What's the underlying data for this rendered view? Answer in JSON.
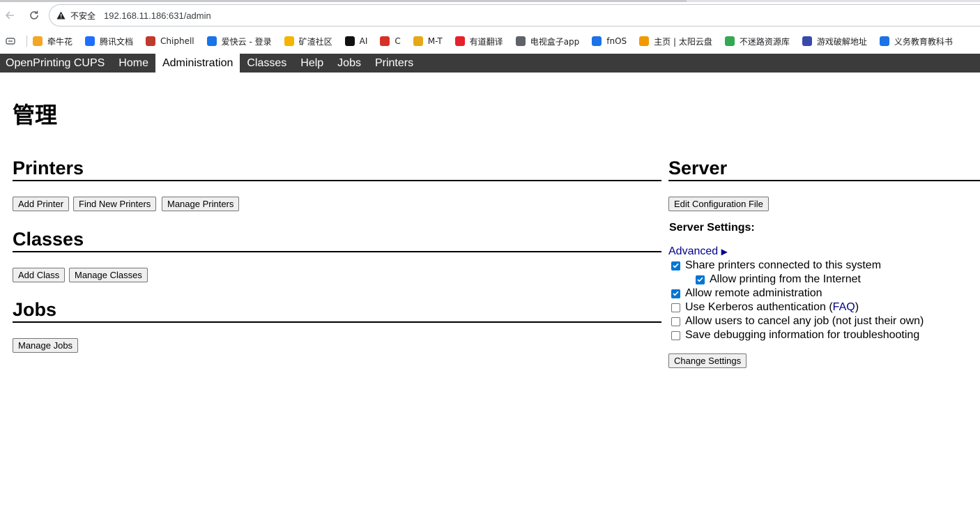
{
  "browser": {
    "insecure_label": "不安全",
    "url": "192.168.11.186:631/admin"
  },
  "bookmarks": [
    {
      "label": "牵牛花",
      "icon": "flower-icon",
      "color": "#f5a623"
    },
    {
      "label": "腾讯文档",
      "icon": "tencent-docs-icon",
      "color": "#1e6fff"
    },
    {
      "label": "Chiphell",
      "icon": "chiphell-icon",
      "color": "#c0392b"
    },
    {
      "label": "爱快云 - 登录",
      "icon": "ikuai-icon",
      "color": "#1a73e8"
    },
    {
      "label": "矿渣社区",
      "icon": "trophy-icon",
      "color": "#f4b400"
    },
    {
      "label": "AI",
      "icon": "ai-icon",
      "color": "#111111"
    },
    {
      "label": "C",
      "icon": "emblem-icon",
      "color": "#d93025"
    },
    {
      "label": "M-T",
      "icon": "mt-icon",
      "color": "#e6a817"
    },
    {
      "label": "有道翻译",
      "icon": "youdao-icon",
      "color": "#e8202a"
    },
    {
      "label": "电视盒子app",
      "icon": "globe-icon",
      "color": "#5f6368"
    },
    {
      "label": "fnOS",
      "icon": "fnos-icon",
      "color": "#1a73e8"
    },
    {
      "label": "主页 | 太阳云盘",
      "icon": "sun-cloud-icon",
      "color": "#f29900"
    },
    {
      "label": "不迷路资源库",
      "icon": "leaf-icon",
      "color": "#34a853"
    },
    {
      "label": "游戏破解地址",
      "icon": "game-icon",
      "color": "#3949ab"
    },
    {
      "label": "义务教育教科书",
      "icon": "textbook-icon",
      "color": "#1a73e8"
    }
  ],
  "menubar": {
    "items": [
      "OpenPrinting CUPS",
      "Home",
      "Administration",
      "Classes",
      "Help",
      "Jobs",
      "Printers"
    ],
    "active": "Administration"
  },
  "page": {
    "title": "管理"
  },
  "printers": {
    "heading": "Printers",
    "buttons": [
      "Add Printer",
      "Find New Printers",
      "Manage Printers"
    ]
  },
  "classes": {
    "heading": "Classes",
    "buttons": [
      "Add Class",
      "Manage Classes"
    ]
  },
  "jobs": {
    "heading": "Jobs",
    "buttons": [
      "Manage Jobs"
    ]
  },
  "server": {
    "heading": "Server",
    "edit_config_label": "Edit Configuration File",
    "settings_label": "Server Settings:",
    "advanced_label": "Advanced",
    "advanced_arrow": "▶",
    "options": [
      {
        "label": "Share printers connected to this system",
        "checked": true
      },
      {
        "label": "Allow printing from the Internet",
        "checked": true
      },
      {
        "label": "Allow remote administration",
        "checked": true
      },
      {
        "label_prefix": "Use Kerberos authentication (",
        "link": "FAQ",
        "label_suffix": ")",
        "checked": false
      },
      {
        "label": "Allow users to cancel any job (not just their own)",
        "checked": false
      },
      {
        "label": "Save debugging information for troubleshooting",
        "checked": false
      }
    ],
    "change_settings_label": "Change Settings"
  },
  "colors": {
    "menubar_bg": "#3b3b3b",
    "link": "#00008b",
    "checkbox_on": "#0075d4"
  }
}
